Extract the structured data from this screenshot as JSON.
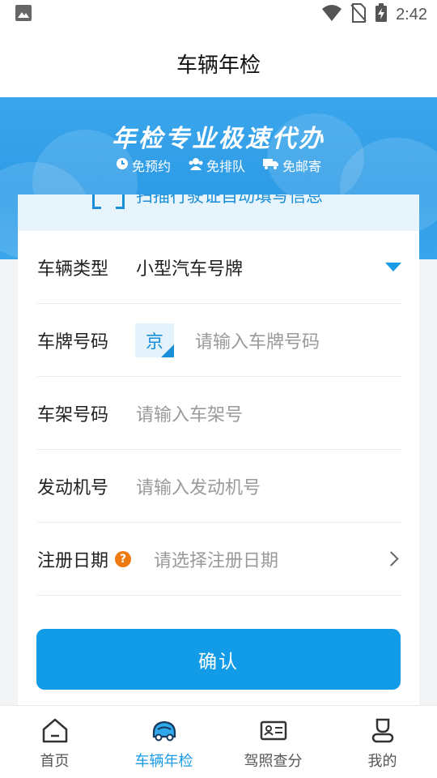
{
  "status_bar": {
    "time": "2:42",
    "icons": [
      "image-icon",
      "wifi-icon",
      "no-sim-icon",
      "battery-charging-icon"
    ]
  },
  "header": {
    "title": "车辆年检"
  },
  "banner": {
    "title": "年检专业极速代办",
    "tags": [
      {
        "icon": "clock-icon",
        "label": "免预约"
      },
      {
        "icon": "people-icon",
        "label": "免排队"
      },
      {
        "icon": "truck-icon",
        "label": "免邮寄"
      }
    ]
  },
  "scan": {
    "label": "扫描行驶证自动填写信息"
  },
  "form": {
    "vehicle_type": {
      "label": "车辆类型",
      "value": "小型汽车号牌"
    },
    "plate": {
      "label": "车牌号码",
      "province": "京",
      "placeholder": "请输入车牌号码"
    },
    "frame": {
      "label": "车架号码",
      "placeholder": "请输入车架号"
    },
    "engine": {
      "label": "发动机号",
      "placeholder": "请输入发动机号"
    },
    "reg_date": {
      "label": "注册日期",
      "help": "?",
      "placeholder": "请选择注册日期"
    }
  },
  "confirm_label": "确认",
  "nav": {
    "items": [
      {
        "label": "首页",
        "icon": "home-icon",
        "active": false
      },
      {
        "label": "车辆年检",
        "icon": "car-icon",
        "active": true
      },
      {
        "label": "驾照查分",
        "icon": "license-icon",
        "active": false
      },
      {
        "label": "我的",
        "icon": "user-icon",
        "active": false
      }
    ]
  },
  "colors": {
    "accent": "#129be6",
    "banner": "#2d9be6",
    "help_badge": "#f07a12"
  }
}
